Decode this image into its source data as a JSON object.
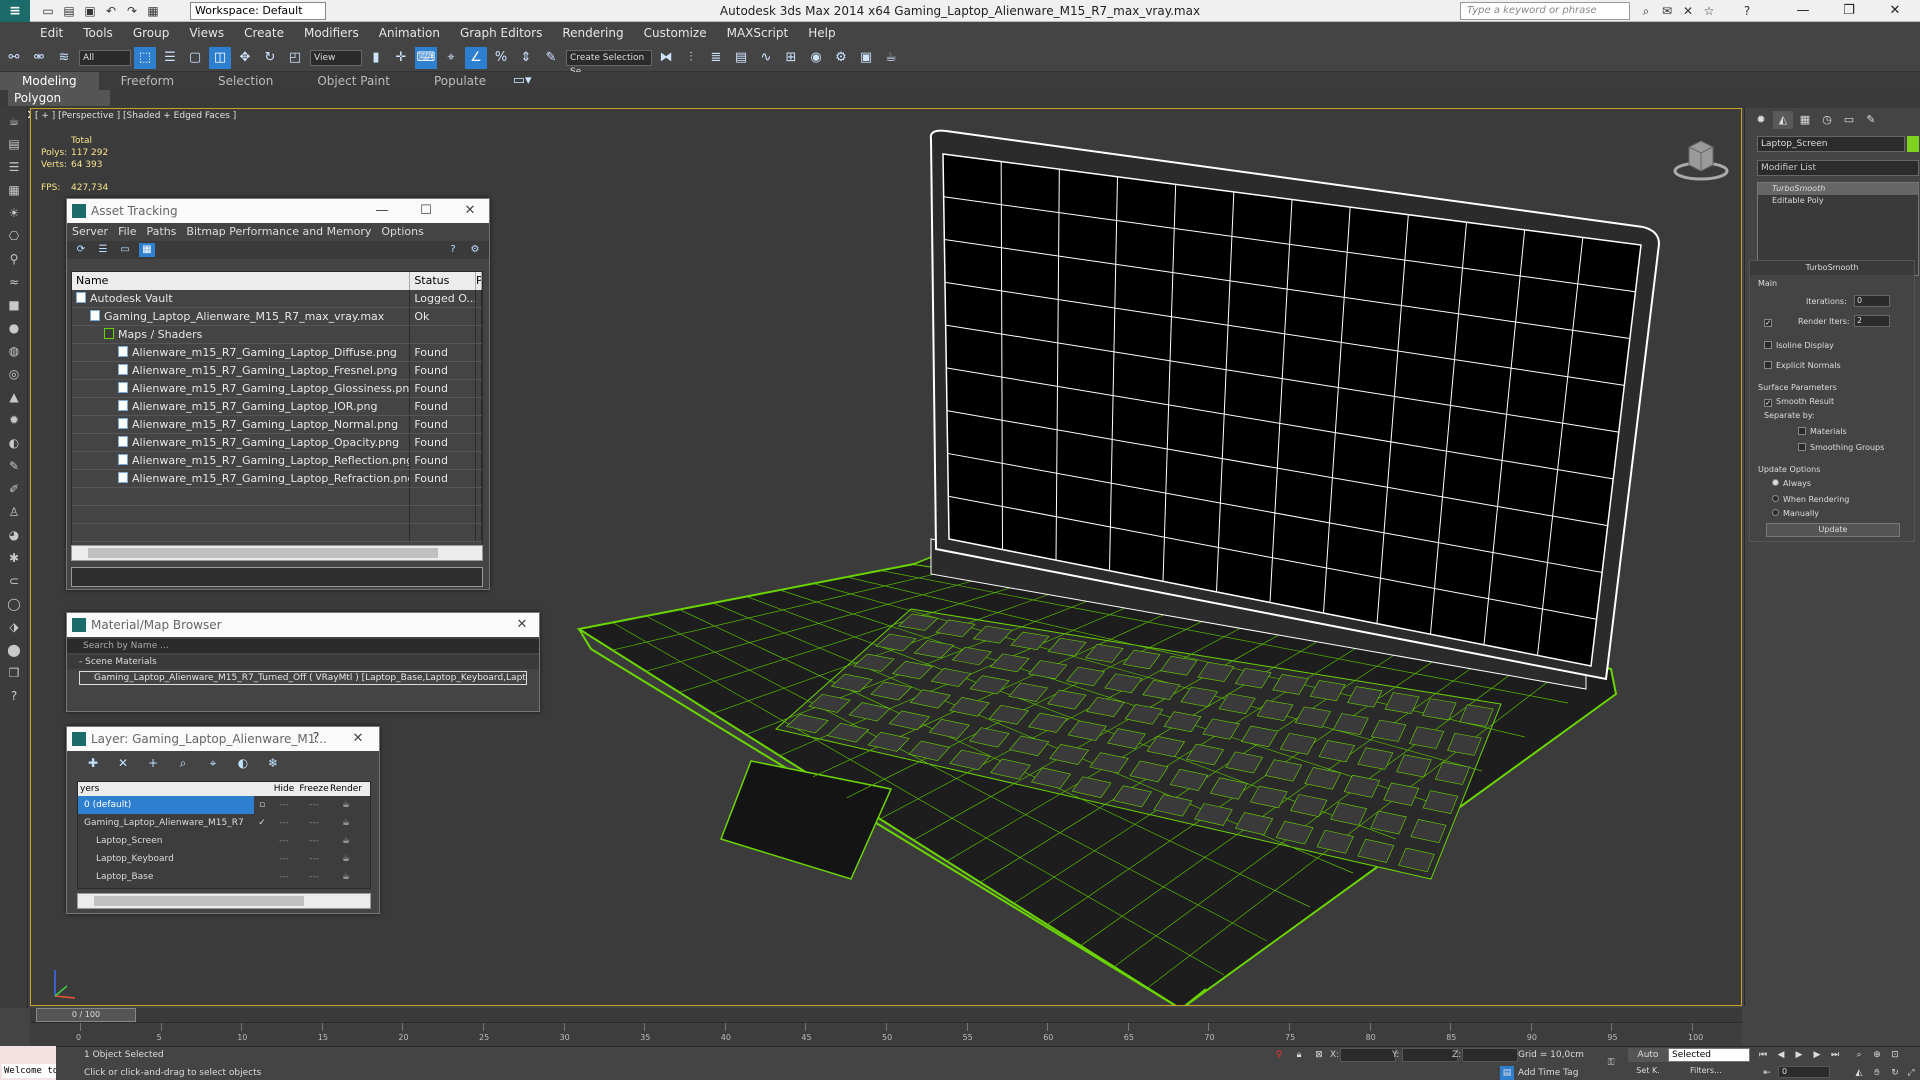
{
  "titlebar": {
    "app_logo": "≡",
    "workspace": "Workspace: Default",
    "title": "Autodesk 3ds Max  2014 x64      Gaming_Laptop_Alienware_M15_R7_max_vray.max",
    "search_placeholder": "Type a keyword or phrase"
  },
  "menu": [
    "Edit",
    "Tools",
    "Group",
    "Views",
    "Create",
    "Modifiers",
    "Animation",
    "Graph Editors",
    "Rendering",
    "Customize",
    "MAXScript",
    "Help"
  ],
  "toolbar": {
    "filter_value": "All",
    "refcoord_value": "View",
    "selection_set_placeholder": "Create Selection Se"
  },
  "ribbon": {
    "tabs": [
      "Modeling",
      "Freeform",
      "Selection",
      "Object Paint",
      "Populate"
    ],
    "active_tab": "Modeling",
    "subpanel": "Polygon Modeling"
  },
  "viewport": {
    "label": "[ + ] [Perspective ] [Shaded + Edged Faces ]",
    "stats_total": "Total",
    "polys_label": "Polys:",
    "polys_value": "117 292",
    "verts_label": "Verts:",
    "verts_value": "64 393",
    "fps_label": "FPS:",
    "fps_value": "427,734"
  },
  "asset_tracking": {
    "title": "Asset Tracking",
    "menu": [
      "Server",
      "File",
      "Paths",
      "Bitmap Performance and Memory",
      "Options"
    ],
    "columns": [
      "Name",
      "Status",
      "Pro"
    ],
    "rows": [
      {
        "name": "Autodesk Vault",
        "status": "Logged O...",
        "indent": 0
      },
      {
        "name": "Gaming_Laptop_Alienware_M15_R7_max_vray.max",
        "status": "Ok",
        "indent": 1
      },
      {
        "name": "Maps / Shaders",
        "status": "",
        "indent": 2
      },
      {
        "name": "Alienware_m15_R7_Gaming_Laptop_Diffuse.png",
        "status": "Found",
        "indent": 3
      },
      {
        "name": "Alienware_m15_R7_Gaming_Laptop_Fresnel.png",
        "status": "Found",
        "indent": 3
      },
      {
        "name": "Alienware_m15_R7_Gaming_Laptop_Glossiness.png",
        "status": "Found",
        "indent": 3
      },
      {
        "name": "Alienware_m15_R7_Gaming_Laptop_IOR.png",
        "status": "Found",
        "indent": 3
      },
      {
        "name": "Alienware_m15_R7_Gaming_Laptop_Normal.png",
        "status": "Found",
        "indent": 3
      },
      {
        "name": "Alienware_m15_R7_Gaming_Laptop_Opacity.png",
        "status": "Found",
        "indent": 3
      },
      {
        "name": "Alienware_m15_R7_Gaming_Laptop_Reflection.png",
        "status": "Found",
        "indent": 3
      },
      {
        "name": "Alienware_m15_R7_Gaming_Laptop_Refraction.png",
        "status": "Found",
        "indent": 3
      }
    ]
  },
  "material_browser": {
    "title": "Material/Map Browser",
    "search_placeholder": "Search by Name ...",
    "section": "- Scene Materials",
    "item": "Gaming_Laptop_Alienware_M15_R7_Turned_Off ( VRayMtl ) [Laptop_Base,Laptop_Keyboard,Laptop_Screen]"
  },
  "layer_manager": {
    "title": "Layer: Gaming_Laptop_Alienware_M1...",
    "help": "?",
    "columns": [
      "yers",
      "Hide",
      "Freeze",
      "Render"
    ],
    "rows": [
      {
        "name": "0 (default)",
        "selected": true
      },
      {
        "name": "Gaming_Laptop_Alienware_M15_R7",
        "selected": false
      },
      {
        "name": "Laptop_Screen",
        "selected": false
      },
      {
        "name": "Laptop_Keyboard",
        "selected": false
      },
      {
        "name": "Laptop_Base",
        "selected": false
      }
    ]
  },
  "command_panel": {
    "object_name": "Laptop_Screen",
    "object_color": "#7ed321",
    "modifier_list": "Modifier List",
    "stack": [
      "TurboSmooth",
      "Editable Poly"
    ],
    "rollout_title": "TurboSmooth",
    "main_label": "Main",
    "iterations_label": "Iterations:",
    "iterations_value": "0",
    "render_iters_label": "Render Iters:",
    "render_iters_value": "2",
    "isoline_display": "Isoline Display",
    "explicit_normals": "Explicit Normals",
    "surface_params": "Surface Parameters",
    "smooth_result": "Smooth Result",
    "separate_by": "Separate by:",
    "materials": "Materials",
    "smoothing_groups": "Smoothing Groups",
    "update_options": "Update Options",
    "always": "Always",
    "when_rendering": "When Rendering",
    "manually": "Manually",
    "update_button": "Update"
  },
  "timeline": {
    "slider": "0 / 100",
    "ticks": [
      "0",
      "5",
      "10",
      "15",
      "20",
      "25",
      "30",
      "35",
      "40",
      "45",
      "50",
      "55",
      "60",
      "65",
      "70",
      "75",
      "80",
      "85",
      "90",
      "95",
      "100"
    ]
  },
  "statusbar": {
    "maxscript": "Welcome to",
    "selection": "1 Object Selected",
    "prompt": "Click or click-and-drag to select objects",
    "x_label": "X:",
    "y_label": "Y:",
    "z_label": "Z:",
    "grid": "Grid = 10,0cm",
    "add_time_tag": "Add Time Tag",
    "auto_key": "Auto",
    "set_key": "Set K.",
    "key_filter": "Selected",
    "filters": "Filters...",
    "frame": "0"
  },
  "colors": {
    "accent": "#2e7fd0",
    "viewport_border": "#c9a227",
    "wire_green": "#6ad400",
    "wire_white": "#ffffff"
  }
}
